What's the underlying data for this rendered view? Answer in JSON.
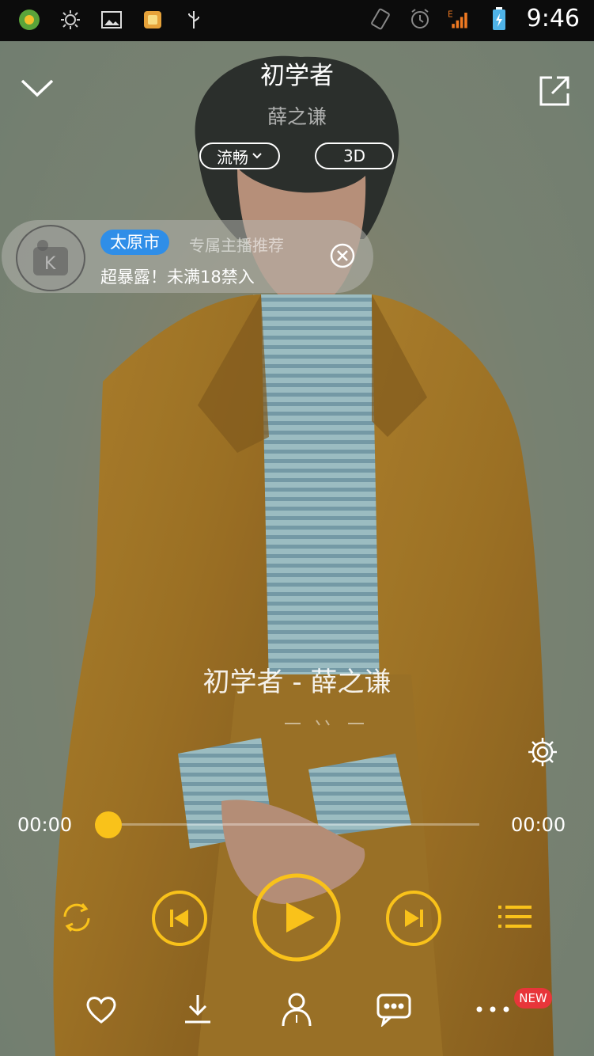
{
  "status_bar": {
    "time": "9:46",
    "left_icons": [
      "app-icon",
      "brightness-icon",
      "gallery-icon",
      "game-icon",
      "usb-icon"
    ],
    "right_icons": [
      "rotate-icon",
      "alarm-icon",
      "signal-icon",
      "battery-icon"
    ],
    "network": "E"
  },
  "header": {
    "title": "初学者",
    "artist": "薛之谦",
    "quality_label": "流畅",
    "threed_label": "3D"
  },
  "banner": {
    "city": "太原市",
    "subtitle": "专属主播推荐",
    "text": "超暴露！未满18禁入"
  },
  "lyric": {
    "line": "初学者 - 薛之谦"
  },
  "progress": {
    "current": "00:00",
    "total": "00:00",
    "fraction": 0
  },
  "colors": {
    "accent": "#f9c21a",
    "badge_blue": "#2f8ee8",
    "new_badge": "#e8353a"
  },
  "bottom_bar": {
    "new_badge": "NEW",
    "icons": [
      "heart-icon",
      "download-icon",
      "singer-icon",
      "comment-icon",
      "more-icon"
    ]
  }
}
